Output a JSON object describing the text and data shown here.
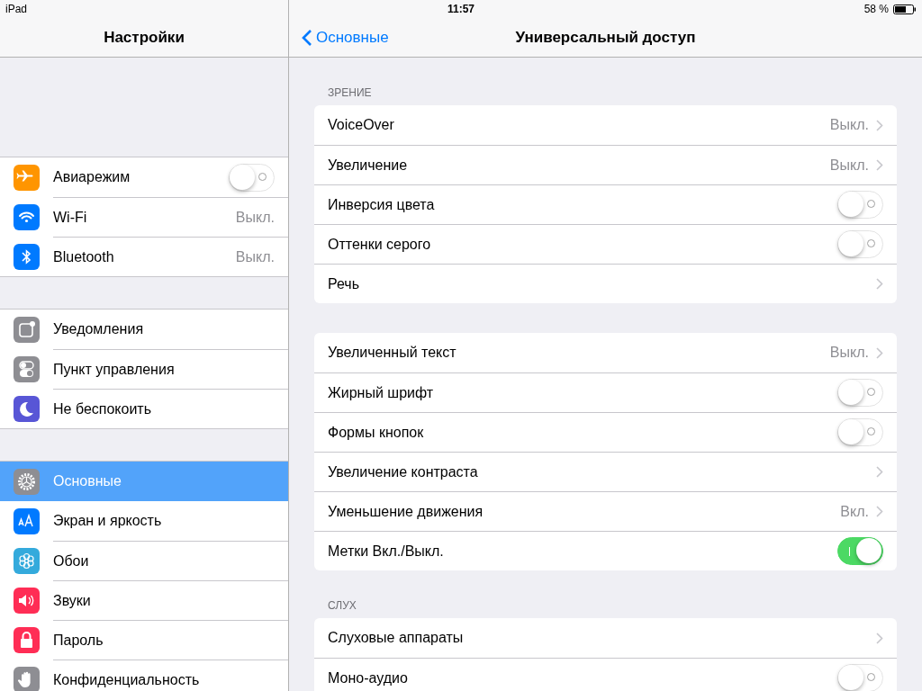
{
  "status_bar": {
    "device": "iPad",
    "time": "11:57",
    "battery": "58 %"
  },
  "sidebar": {
    "title": "Настройки",
    "groups": [
      [
        {
          "label": "Авиарежим",
          "color": "#ff9500",
          "kind": "toggle",
          "on": false,
          "selected": false
        },
        {
          "label": "Wi-Fi",
          "color": "#007aff",
          "kind": "detail",
          "value": "Выкл.",
          "selected": false
        },
        {
          "label": "Bluetooth",
          "color": "#007aff",
          "kind": "detail",
          "value": "Выкл.",
          "selected": false
        }
      ],
      [
        {
          "label": "Уведомления",
          "color": "#8e8e93",
          "kind": "detail",
          "selected": false
        },
        {
          "label": "Пункт управления",
          "color": "#8e8e93",
          "kind": "detail",
          "selected": false
        },
        {
          "label": "Не беспокоить",
          "color": "#5856d6",
          "kind": "detail",
          "selected": false
        }
      ],
      [
        {
          "label": "Основные",
          "color": "#8e8e93",
          "kind": "detail",
          "selected": true
        },
        {
          "label": "Экран и яркость",
          "color": "#007aff",
          "kind": "detail",
          "selected": false
        },
        {
          "label": "Обои",
          "color": "#34aadc",
          "kind": "detail",
          "selected": false
        },
        {
          "label": "Звуки",
          "color": "#ff2d55",
          "kind": "detail",
          "selected": false
        },
        {
          "label": "Пароль",
          "color": "#ff2d55",
          "kind": "detail",
          "selected": false
        },
        {
          "label": "Конфиденциальность",
          "color": "#8e8e93",
          "kind": "detail",
          "selected": false
        }
      ]
    ]
  },
  "detail": {
    "back": "Основные",
    "title": "Универсальный доступ",
    "sections": [
      {
        "header": "ЗРЕНИЕ",
        "rows": [
          {
            "label": "VoiceOver",
            "kind": "detail",
            "value": "Выкл."
          },
          {
            "label": "Увеличение",
            "kind": "detail",
            "value": "Выкл."
          },
          {
            "label": "Инверсия цвета",
            "kind": "toggle",
            "on": false
          },
          {
            "label": "Оттенки серого",
            "kind": "toggle",
            "on": false
          },
          {
            "label": "Речь",
            "kind": "detail"
          }
        ]
      },
      {
        "rows": [
          {
            "label": "Увеличенный текст",
            "kind": "detail",
            "value": "Выкл."
          },
          {
            "label": "Жирный шрифт",
            "kind": "toggle",
            "on": false
          },
          {
            "label": "Формы кнопок",
            "kind": "toggle",
            "on": false
          },
          {
            "label": "Увеличение контраста",
            "kind": "detail"
          },
          {
            "label": "Уменьшение движения",
            "kind": "detail",
            "value": "Вкл."
          },
          {
            "label": "Метки Вкл./Выкл.",
            "kind": "toggle",
            "on": true
          }
        ]
      },
      {
        "header": "СЛУХ",
        "rows": [
          {
            "label": "Слуховые аппараты",
            "kind": "detail"
          },
          {
            "label": "Моно-аудио",
            "kind": "toggle",
            "on": false
          }
        ]
      }
    ]
  }
}
